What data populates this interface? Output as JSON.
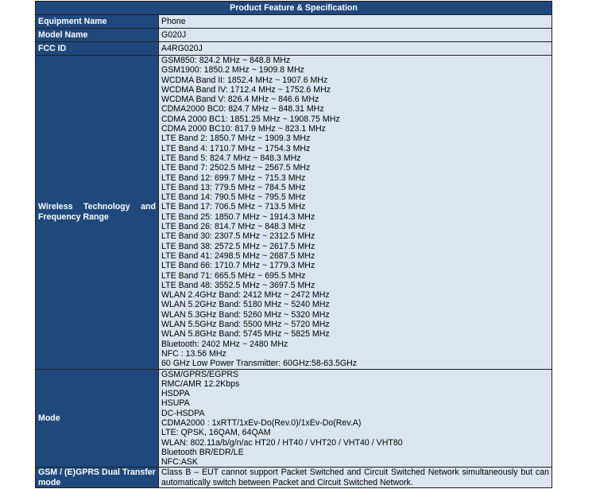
{
  "title": "Product Feature & Specification",
  "rows": {
    "equipment_name": {
      "label": "Equipment Name",
      "value": "Phone"
    },
    "model_name": {
      "label": "Model Name",
      "value": "G020J"
    },
    "fcc_id": {
      "label": "FCC ID",
      "value": "A4RG020J"
    },
    "wireless": {
      "label": "Wireless Technology and Frequency Range",
      "values": [
        "GSM850: 824.2 MHz ~ 848.8 MHz",
        "GSM1900: 1850.2 MHz ~ 1909.8 MHz",
        "WCDMA Band II: 1852.4 MHz ~ 1907.6 MHz",
        "WCDMA Band IV: 1712.4 MHz ~ 1752.6 MHz",
        "WCDMA Band V: 826.4 MHz ~ 846.6 MHz",
        "CDMA2000 BC0: 824.7 MHz ~ 848.31 MHz",
        "CDMA 2000 BC1: 1851.25 MHz ~ 1908.75 MHz",
        "CDMA 2000 BC10: 817.9 MHz ~ 823.1 MHz",
        "LTE Band 2: 1850.7 MHz ~ 1909.3 MHz",
        "LTE Band 4: 1710.7 MHz ~ 1754.3 MHz",
        "LTE Band 5: 824.7 MHz ~ 848.3 MHz",
        "LTE Band 7: 2502.5 MHz ~ 2567.5 MHz",
        "LTE Band 12: 699.7 MHz ~ 715.3 MHz",
        "LTE Band 13: 779.5 MHz ~ 784.5 MHz",
        "LTE Band 14: 790.5 MHz ~ 795.5 MHz",
        "LTE Band 17: 706.5 MHz ~ 713.5 MHz",
        "LTE Band 25: 1850.7 MHz ~ 1914.3 MHz",
        "LTE Band 26: 814.7 MHz ~ 848.3 MHz",
        "LTE Band 30: 2307.5 MHz ~ 2312.5 MHz",
        "LTE Band 38: 2572.5 MHz ~ 2617.5 MHz",
        "LTE Band 41: 2498.5 MHz ~ 2687.5 MHz",
        "LTE Band 66: 1710.7 MHz ~ 1779.3 MHz",
        "LTE Band 71: 665.5 MHz ~ 695.5 MHz",
        "LTE Band 48: 3552.5 MHz ~ 3697.5 MHz",
        "WLAN 2.4GHz Band: 2412 MHz ~ 2472 MHz",
        "WLAN 5.2GHz Band: 5180 MHz ~ 5240 MHz",
        "WLAN 5.3GHz Band: 5260 MHz ~ 5320 MHz",
        "WLAN 5.5GHz Band: 5500 MHz ~ 5720 MHz",
        "WLAN 5.8GHz Band: 5745 MHz ~ 5825 MHz",
        "Bluetooth: 2402 MHz ~ 2480 MHz",
        "NFC : 13.56 MHz",
        "60 GHz Low Power Transmitter: 60GHz:58-63.5GHz"
      ]
    },
    "mode": {
      "label": "Mode",
      "values": [
        "GSM/GPRS/EGPRS",
        "RMC/AMR 12.2Kbps",
        "HSDPA",
        "HSUPA",
        "DC-HSDPA",
        "CDMA2000 : 1xRTT/1xEv-Do(Rev.0)/1xEv-Do(Rev.A)",
        "LTE: QPSK, 16QAM, 64QAM",
        "WLAN: 802.11a/b/g/n/ac HT20 / HT40 / VHT20 / VHT40 / VHT80",
        "Bluetooth BR/EDR/LE",
        "NFC:ASK"
      ]
    },
    "dual_transfer": {
      "label": "GSM / (E)GPRS Dual Transfer mode",
      "value": "Class B – EUT cannot support Packet Switched and Circuit Switched Network simultaneously but can automatically switch between Packet and Circuit Switched Network."
    }
  }
}
